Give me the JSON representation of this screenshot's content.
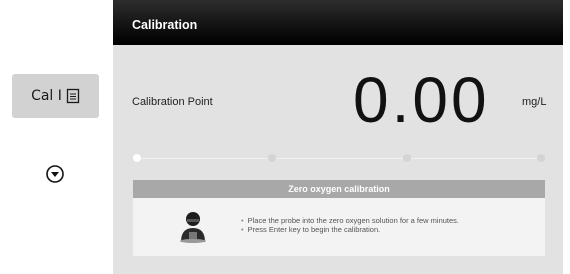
{
  "side_panel": {
    "cal_button_label": "Cal I",
    "cal_button_icon": "document-icon",
    "down_icon": "chevron-down-circle-icon"
  },
  "screen": {
    "title": "Calibration",
    "calibration_point_label": "Calibration Point",
    "value": "0.00",
    "unit": "mg/L",
    "progress": {
      "steps": 4,
      "current_step": 1
    },
    "info_box": {
      "title": "Zero oxygen calibration",
      "avatar_icon": "operator-avatar-icon",
      "instructions": [
        "Place the probe into the zero oxygen solution for a few minutes.",
        "Press Enter key to begin the calibration."
      ]
    }
  }
}
